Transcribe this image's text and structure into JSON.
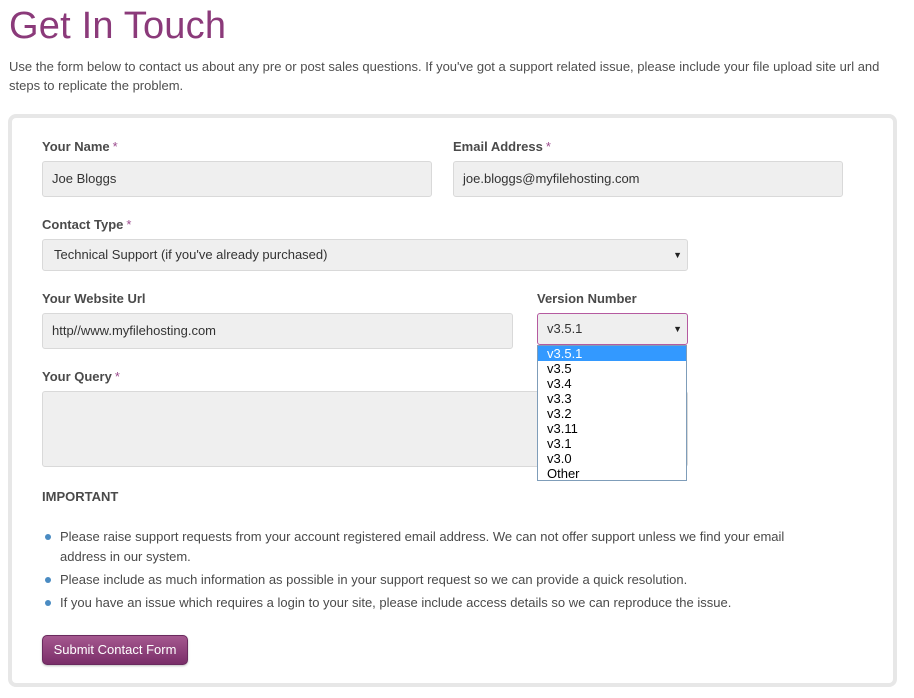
{
  "page": {
    "title": "Get In Touch",
    "intro": "Use the form below to contact us about any pre or post sales questions. If you've got a support related issue, please include your file upload site url and steps to replicate the problem."
  },
  "form": {
    "required_marker": "*",
    "name": {
      "label": "Your Name",
      "value": "Joe Bloggs"
    },
    "email": {
      "label": "Email Address",
      "value": "joe.bloggs@myfilehosting.com"
    },
    "contact_type": {
      "label": "Contact Type",
      "selected": "Technical Support (if you've already purchased)"
    },
    "website": {
      "label": "Your Website Url",
      "value": "http//www.myfilehosting.com"
    },
    "version": {
      "label": "Version Number",
      "selected": "v3.5.1",
      "options": [
        "v3.5.1",
        "v3.5",
        "v3.4",
        "v3.3",
        "v3.2",
        "v3.11",
        "v3.1",
        "v3.0",
        "Other"
      ],
      "highlighted_index": 0
    },
    "query": {
      "label": "Your Query",
      "value": ""
    }
  },
  "important": {
    "heading": "IMPORTANT",
    "notes": [
      "Please raise support requests from your account registered email address. We can not offer support unless we find your email address in our system.",
      "Please include as much information as possible in your support request so we can provide a quick resolution.",
      "If you have an issue which requires a login to your site, please include access details so we can reproduce the issue."
    ]
  },
  "submit": {
    "label": "Submit Contact Form"
  },
  "colors": {
    "title": "#8b3a7a",
    "required": "#9a4a8c",
    "button": "#8a3a78",
    "highlight": "#3399ff",
    "bullet": "#4a8bc2"
  },
  "icons": {
    "select_arrow": "dropdown-arrow-icon",
    "bullet": "bullet-icon"
  }
}
